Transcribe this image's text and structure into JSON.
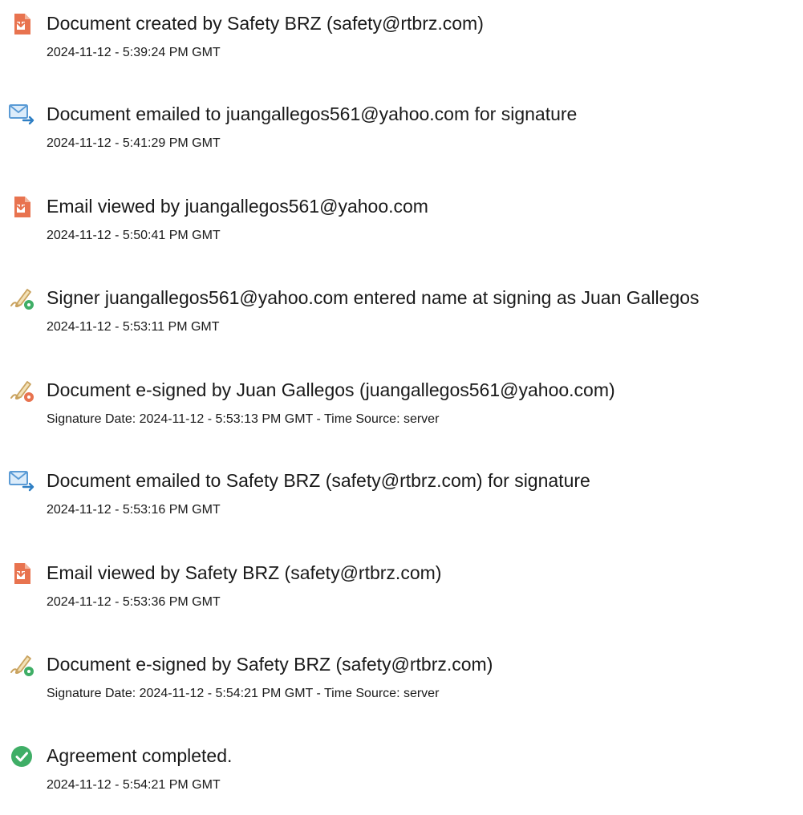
{
  "events": [
    {
      "icon": "document-created-icon",
      "title": "Document created by Safety BRZ (safety@rtbrz.com)",
      "meta": "2024-11-12 - 5:39:24 PM GMT"
    },
    {
      "icon": "document-emailed-icon",
      "title": "Document emailed to juangallegos561@yahoo.com for signature",
      "meta": "2024-11-12 - 5:41:29 PM GMT"
    },
    {
      "icon": "document-viewed-icon",
      "title": "Email viewed by juangallegos561@yahoo.com",
      "meta": "2024-11-12 - 5:50:41 PM GMT"
    },
    {
      "icon": "e-signature-icon",
      "title": "Signer juangallegos561@yahoo.com entered name at signing as Juan Gallegos",
      "meta": "2024-11-12 - 5:53:11 PM GMT"
    },
    {
      "icon": "e-signature-icon",
      "title": "Document e-signed by Juan Gallegos (juangallegos561@yahoo.com)",
      "meta": "Signature Date: 2024-11-12 - 5:53:13 PM GMT - Time Source: server"
    },
    {
      "icon": "document-emailed-icon",
      "title": "Document emailed to Safety BRZ (safety@rtbrz.com) for signature",
      "meta": "2024-11-12 - 5:53:16 PM GMT"
    },
    {
      "icon": "document-viewed-icon",
      "title": "Email viewed by Safety BRZ (safety@rtbrz.com)",
      "meta": "2024-11-12 - 5:53:36 PM GMT"
    },
    {
      "icon": "e-signature-icon",
      "title": "Document e-signed by Safety BRZ (safety@rtbrz.com)",
      "meta": "Signature Date: 2024-11-12 - 5:54:21 PM GMT - Time Source: server"
    },
    {
      "icon": "agreement-completed-icon",
      "title": "Agreement completed.",
      "meta": "2024-11-12 - 5:54:21 PM GMT"
    }
  ],
  "colors": {
    "document_icon": "#e8734f",
    "email_icon": "#5b9bd5",
    "signature_pen": "#c9a25e",
    "signature_badge": "#3fae66",
    "completed_check": "#3fae66",
    "text": "#1a1a1a"
  }
}
